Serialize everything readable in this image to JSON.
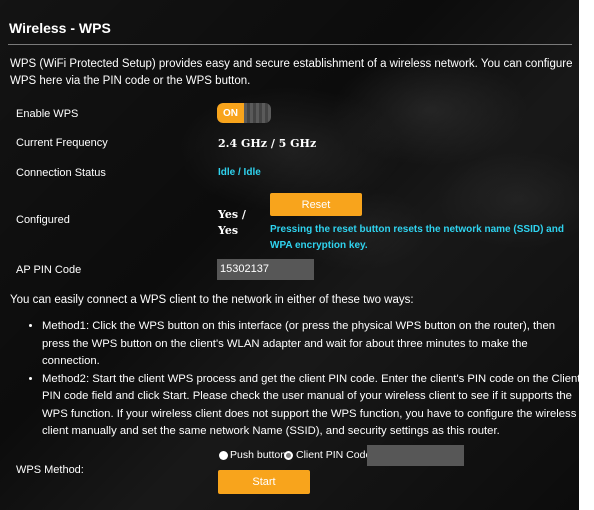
{
  "title": "Wireless - WPS",
  "description": "WPS (WiFi Protected Setup) provides easy and secure establishment of a wireless network. You can configure WPS here via the PIN code or the WPS button.",
  "fields": {
    "enable_wps": {
      "label": "Enable WPS",
      "toggle_text": "ON",
      "state": "on"
    },
    "current_frequency": {
      "label": "Current Frequency",
      "value": "2.4 GHz / 5 GHz"
    },
    "connection_status": {
      "label": "Connection Status",
      "value": "Idle / Idle"
    },
    "configured": {
      "label": "Configured",
      "value_line1": "Yes /",
      "value_line2": "Yes",
      "reset_button": "Reset",
      "reset_note": "Pressing the reset button resets the network name (SSID) and WPA encryption key."
    },
    "ap_pin": {
      "label": "AP PIN Code",
      "value": "15302137"
    }
  },
  "intro": "You can easily connect a WPS client to the network in either of these two ways:",
  "methods": [
    "Method1: Click the WPS button on this interface (or press the physical WPS button on the router), then press the WPS button on the client's WLAN adapter and wait for about three minutes to make the connection.",
    "Method2: Start the client WPS process and get the client PIN code. Enter the client's PIN code on the Client PIN code field and click Start. Please check the user manual of your wireless client to see if it supports the WPS function. If your wireless client does not support the WPS function, you have to configure the wireless client manually and set the same network Name (SSID), and security settings as this router."
  ],
  "wps_method": {
    "label": "WPS Method:",
    "options": [
      "Push button",
      "Client PIN Code"
    ],
    "selected": "Client PIN Code",
    "client_pin_value": "",
    "start_button": "Start"
  },
  "colors": {
    "accent": "#f8a41c",
    "status": "#2fd3ef",
    "background": "#0c0c0c"
  }
}
